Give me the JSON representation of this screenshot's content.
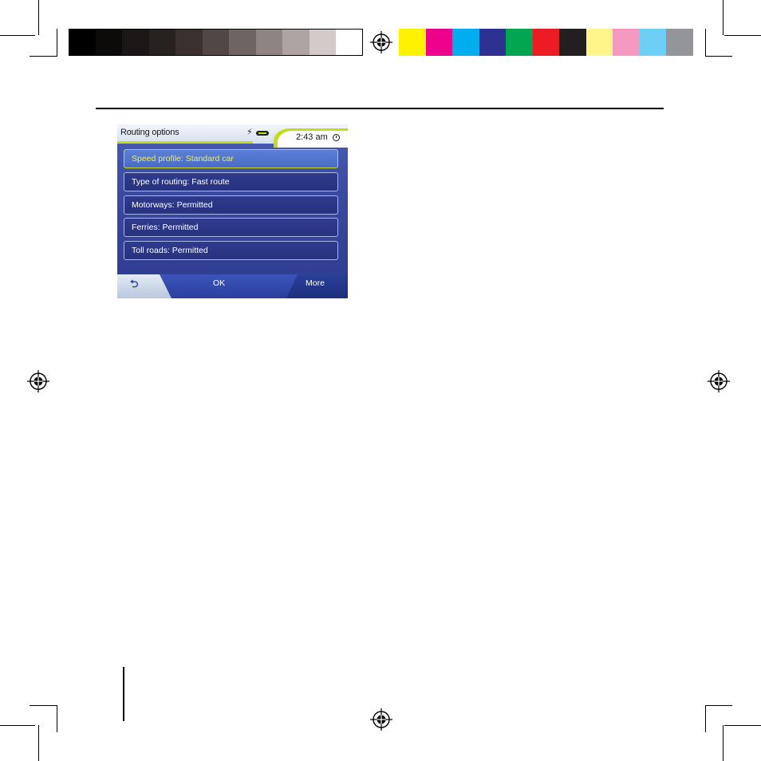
{
  "colors": {
    "accent": "#c6dc1a",
    "screen_blue": "#2d3b8e",
    "selected_text": "#e6f06a",
    "grayscale_swatches": [
      "#000000",
      "#0d0b0a",
      "#1b1716",
      "#272120",
      "#3a312e",
      "#514845",
      "#6e6461",
      "#8e8481",
      "#aea5a2",
      "#d2cbc9",
      "#ffffff"
    ],
    "color_swatches": [
      "#fff200",
      "#ec008c",
      "#00aeef",
      "#2e3192",
      "#00a651",
      "#ed1c24",
      "#231f20",
      "#fff589",
      "#f49ac1",
      "#6dcff6",
      "#939598"
    ]
  },
  "device": {
    "title": "Routing options",
    "time": "2:43 am",
    "icons": {
      "power": "lightning-icon",
      "battery": "battery-icon",
      "clock": "clock-icon",
      "back": "back-arrow-icon"
    },
    "options": [
      {
        "label": "Speed profile: Standard car",
        "selected": true
      },
      {
        "label": "Type of routing: Fast route",
        "selected": false
      },
      {
        "label": "Motorways: Permitted",
        "selected": false
      },
      {
        "label": "Ferries: Permitted",
        "selected": false
      },
      {
        "label": "Toll roads: Permitted",
        "selected": false
      }
    ],
    "buttons": {
      "back_glyph": "⮌",
      "ok": "OK",
      "more": "More"
    }
  }
}
